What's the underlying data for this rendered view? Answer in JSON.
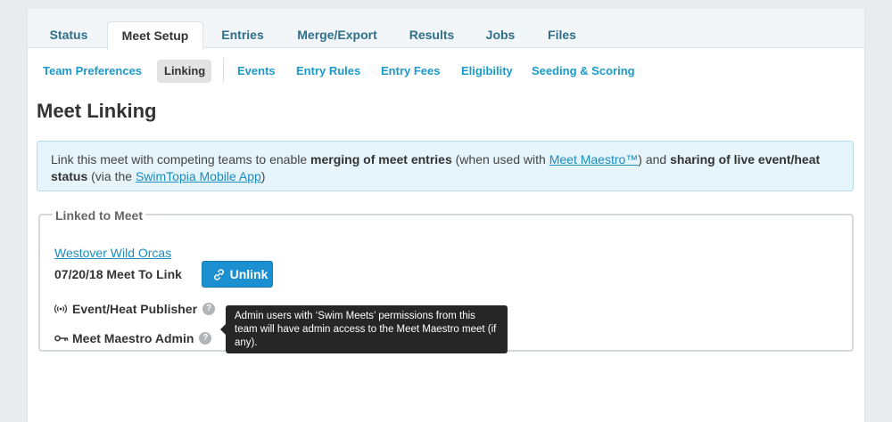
{
  "tabs": [
    {
      "label": "Status"
    },
    {
      "label": "Meet Setup"
    },
    {
      "label": "Entries"
    },
    {
      "label": "Merge/Export"
    },
    {
      "label": "Results"
    },
    {
      "label": "Jobs"
    },
    {
      "label": "Files"
    }
  ],
  "active_tab": "Meet Setup",
  "subnav": [
    {
      "label": "Team Preferences"
    },
    {
      "label": "Linking"
    },
    {
      "label": "Events"
    },
    {
      "label": "Entry Rules"
    },
    {
      "label": "Entry Fees"
    },
    {
      "label": "Eligibility"
    },
    {
      "label": "Seeding & Scoring"
    }
  ],
  "active_subnav": "Linking",
  "page_title": "Meet Linking",
  "info": {
    "t1": "Link this meet with competing teams to enable ",
    "b1": "merging of meet entries",
    "t2": " (when used with ",
    "link1": "Meet Maestro™",
    "t3": ") and ",
    "b2": "sharing of live event/heat status",
    "t4": " (via the ",
    "link2": "SwimTopia Mobile App",
    "t5": ")"
  },
  "linked": {
    "legend": "Linked to Meet",
    "team_name": "Westover Wild Orcas",
    "meet_name": "07/20/18 Meet To Link",
    "unlink_label": "Unlink",
    "permissions": [
      {
        "label": "Event/Heat Publisher",
        "icon": "broadcast-icon"
      },
      {
        "label": "Meet Maestro Admin",
        "icon": "key-icon"
      }
    ],
    "help_glyph": "?"
  },
  "tooltip": {
    "text": "Admin users with ‘Swim Meets’ permissions from this team will have admin access to the Meet Maestro meet (if any)."
  },
  "colors": {
    "accent": "#1a9ac9",
    "button": "#1b8fd0",
    "info_bg": "#e6f4fb",
    "tooltip_bg": "#262626"
  }
}
